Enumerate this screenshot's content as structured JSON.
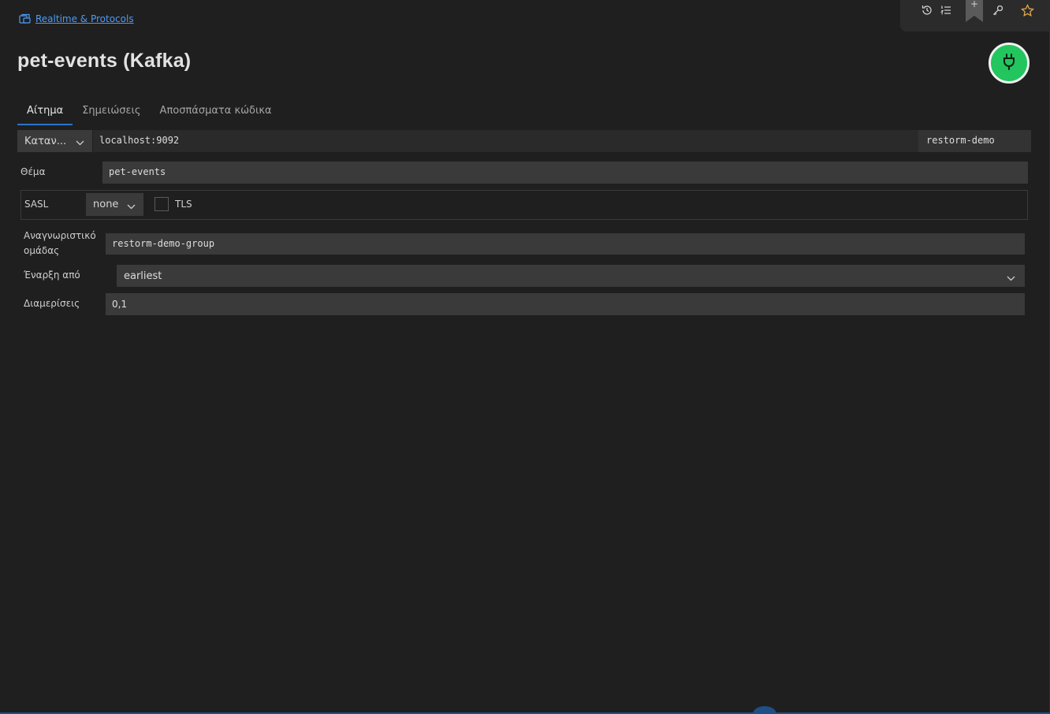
{
  "breadcrumb": {
    "label": "Realtime & Protocols",
    "icon": "collection-icon"
  },
  "toolbar": {
    "icons": [
      "history-icon",
      "list-icon",
      "bookmark-icon",
      "key-icon",
      "star-icon"
    ],
    "bookmark_plus": "+",
    "star_color": "#e0a94a"
  },
  "title": "pet-events (Kafka)",
  "connect_button": {
    "icon": "plug-icon",
    "color": "#22c55e"
  },
  "tabs": [
    {
      "label": "Αίτημα",
      "active": true
    },
    {
      "label": "Σημειώσεις",
      "active": false
    },
    {
      "label": "Αποσπάσματα κώδικα",
      "active": false
    }
  ],
  "connection": {
    "mode": "Καταν...",
    "broker": "localhost:9092",
    "environment": "restorm-demo"
  },
  "topic": {
    "label": "Θέμα",
    "value": "pet-events"
  },
  "sasl": {
    "label": "SASL",
    "value": "none",
    "tls_label": "TLS",
    "tls_checked": false
  },
  "group": {
    "label_line1": "Αναγνωριστικό",
    "label_line2": "ομάδας",
    "value": "restorm-demo-group"
  },
  "start": {
    "label": "Έναρξη από",
    "value": "earliest"
  },
  "partitions": {
    "label": "Διαμερίσεις",
    "value": "0,1"
  }
}
